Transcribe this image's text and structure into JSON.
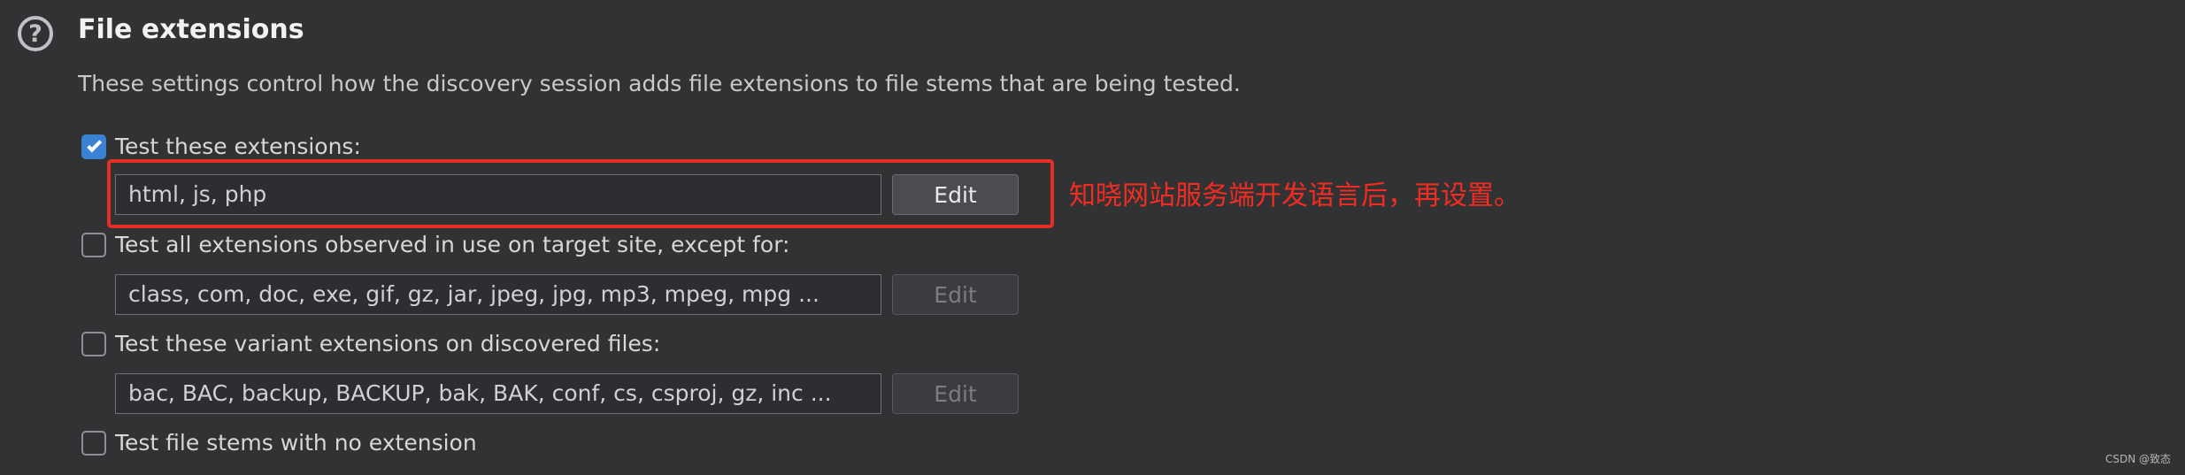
{
  "section": {
    "title": "File extensions",
    "description": "These settings control how the discovery session adds file extensions to file stems that are being tested.",
    "help_icon": "question-circle-icon",
    "help_symbol": "?"
  },
  "options": [
    {
      "label": "Test these extensions:",
      "checked": true,
      "field_value": "html, js, php",
      "button_label": "Edit",
      "button_enabled": true
    },
    {
      "label": "Test all extensions observed in use on target site, except for:",
      "checked": false,
      "field_value": "class, com, doc, exe, gif, gz, jar, jpeg, jpg, mp3, mpeg, mpg ...",
      "button_label": "Edit",
      "button_enabled": false
    },
    {
      "label": "Test these variant extensions on discovered files:",
      "checked": false,
      "field_value": "bac, BAC, backup, BACKUP, bak, BAK, conf, cs, csproj, gz, inc ...",
      "button_label": "Edit",
      "button_enabled": false
    },
    {
      "label": "Test file stems with no extension",
      "checked": false
    }
  ],
  "annotation": {
    "text": "知晓网站服务端开发语言后，再设置。",
    "color": "#f32c21"
  },
  "watermark": "CSDN @致态",
  "colors": {
    "background": "#313234",
    "accent": "#3c82d4",
    "highlight": "#e63025"
  }
}
